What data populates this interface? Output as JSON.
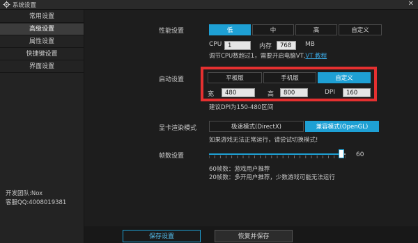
{
  "window": {
    "title": "系统设置",
    "close_glyph": "✕"
  },
  "sidebar": {
    "items": [
      {
        "label": "常用设置",
        "active": false
      },
      {
        "label": "高级设置",
        "active": true
      },
      {
        "label": "属性设置",
        "active": false
      },
      {
        "label": "快捷键设置",
        "active": false
      },
      {
        "label": "界面设置",
        "active": false
      }
    ],
    "dev_team": "开发团队:Nox",
    "support_qq": "客服QQ:4008019381"
  },
  "performance": {
    "label": "性能设置",
    "options": [
      "低",
      "中",
      "高",
      "自定义"
    ],
    "selected": "低",
    "cpu_label": "CPU",
    "cpu_value": "1",
    "mem_label": "内存",
    "mem_value": "768",
    "mem_unit": "MB",
    "hint": "调节CPU数超过1，需要开启电脑VT,",
    "hint_link": "VT 教程"
  },
  "startup": {
    "label": "启动设置",
    "options": [
      "平板版",
      "手机版",
      "自定义"
    ],
    "selected": "自定义",
    "width_label": "宽",
    "width_value": "480",
    "height_label": "高",
    "height_value": "800",
    "dpi_label": "DPI",
    "dpi_value": "160",
    "hint": "建议DPI为150-480区间"
  },
  "render": {
    "label": "显卡渲染模式",
    "options": [
      "极速模式(DirectX)",
      "兼容模式(OpenGL)"
    ],
    "selected": "兼容模式(OpenGL)",
    "hint": "如果游戏无法正常运行，请尝试切换模式!"
  },
  "fps": {
    "label": "帧数设置",
    "value": "60",
    "level": 0.97,
    "hint1": "60帧数：游戏用户推荐",
    "hint2": "20帧数：多开用户推荐，少数游戏可能无法运行"
  },
  "footer": {
    "save_label": "保存设置",
    "restore_label": "恢复并保存"
  },
  "colors": {
    "accent": "#1ea0d4",
    "highlight_box": "#e53030"
  }
}
